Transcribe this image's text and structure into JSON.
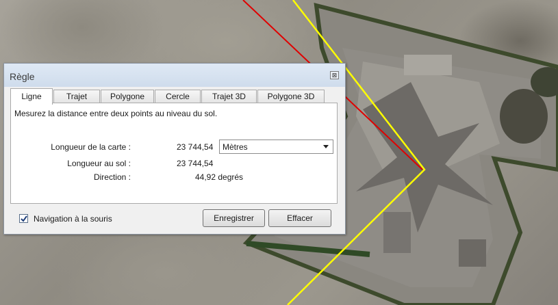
{
  "window": {
    "title": "Règle",
    "close_glyph": "⊠"
  },
  "tabs": [
    {
      "label": "Ligne",
      "active": true
    },
    {
      "label": "Trajet",
      "active": false
    },
    {
      "label": "Polygone",
      "active": false
    },
    {
      "label": "Cercle",
      "active": false
    },
    {
      "label": "Trajet 3D",
      "active": false
    },
    {
      "label": "Polygone 3D",
      "active": false
    }
  ],
  "panel": {
    "description": "Mesurez la distance entre deux points au niveau du sol.",
    "map_length_label": "Longueur de la carte :",
    "map_length_value": "23 744,54",
    "unit_selected": "Mètres",
    "ground_length_label": "Longueur au sol :",
    "ground_length_value": "23 744,54",
    "direction_label": "Direction :",
    "direction_value": "44,92 degrés"
  },
  "footer": {
    "mouse_nav_label": "Navigation à la souris",
    "mouse_nav_checked": true,
    "save_label": "Enregistrer",
    "clear_label": "Effacer"
  },
  "colors": {
    "measure_line": "#e00000",
    "path_line": "#ffff00"
  }
}
